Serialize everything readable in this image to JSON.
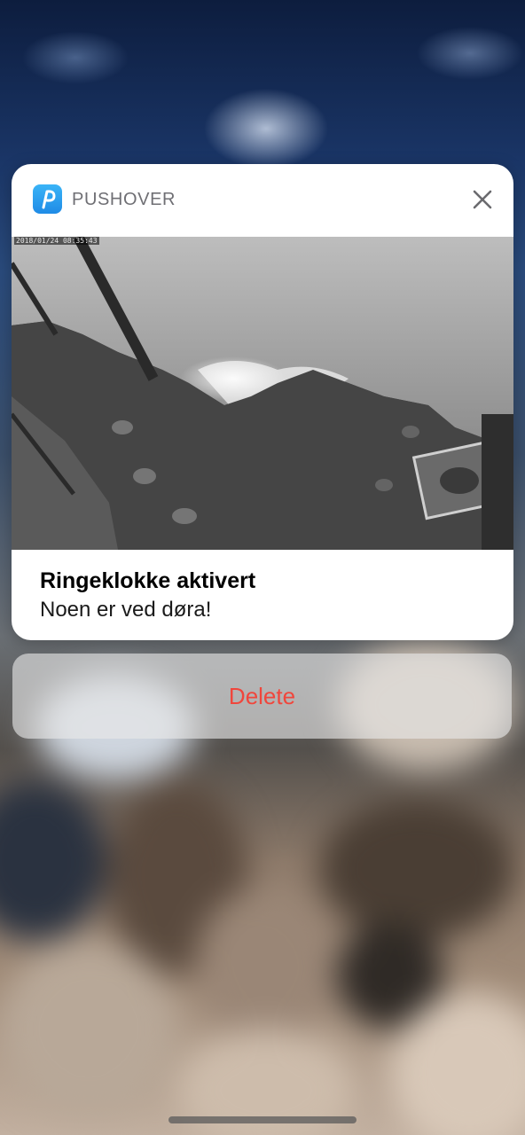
{
  "notification": {
    "app_name": "PUSHOVER",
    "app_icon": "pushover-p-icon",
    "close_icon": "close-icon",
    "image": {
      "description_icon": "doorbell-camera-snapshot",
      "timestamp": "2018/01/24 08:35:43"
    },
    "title": "Ringeklokke aktivert",
    "body": "Noen er ved døra!"
  },
  "actions": {
    "delete_label": "Delete",
    "delete_color": "#f0463c"
  },
  "colors": {
    "app_icon_accent": "#1f8be6"
  }
}
